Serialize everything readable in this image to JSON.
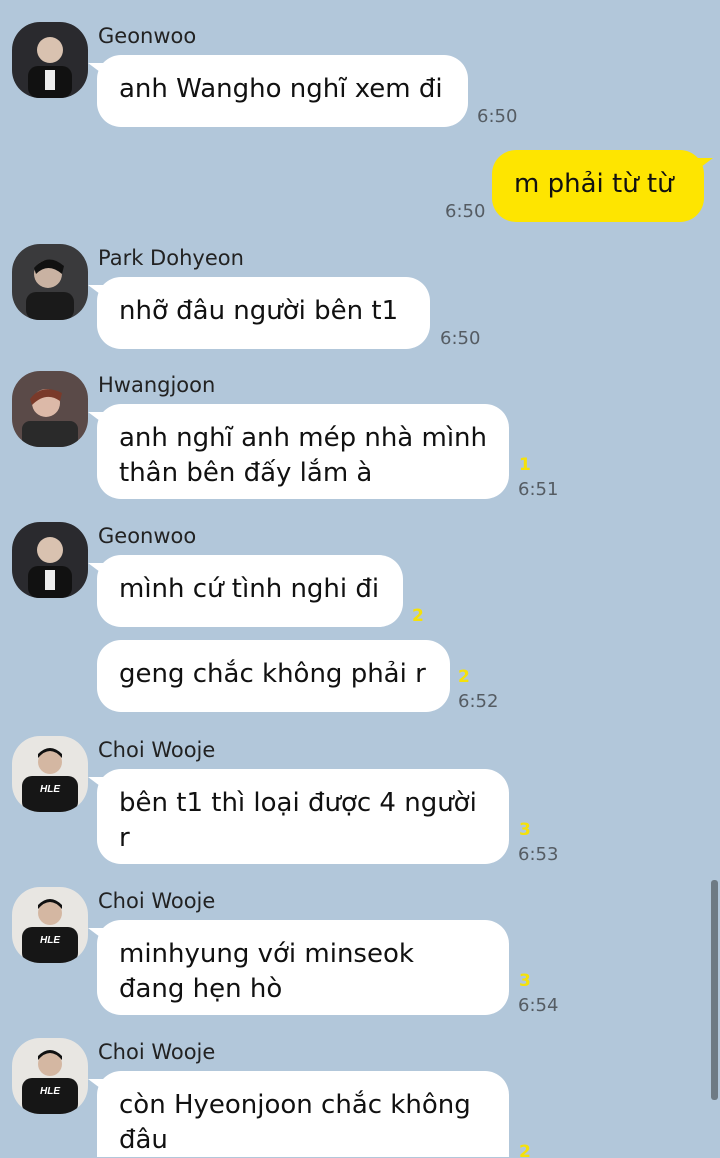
{
  "messages": [
    {
      "sender": "Geonwoo",
      "avatar": "geonwoo-avatar",
      "text": "anh Wangho nghĩ xem đi",
      "time": "6:50"
    },
    {
      "mine": true,
      "text": "m phải từ từ",
      "time": "6:50"
    },
    {
      "sender": "Park Dohyeon",
      "avatar": "park-dohyeon-avatar",
      "text": "nhỡ đâu người bên t1",
      "time": "6:50"
    },
    {
      "sender": "Hwangjoon",
      "avatar": "hwangjoon-avatar",
      "text_lines": [
        "anh nghĩ anh mép nhà mình",
        "thân bên đấy lắm à"
      ],
      "unread": "1",
      "time": "6:51"
    },
    {
      "sender": "Geonwoo",
      "avatar": "geonwoo-avatar",
      "text": "mình cứ tình nghi đi",
      "unread": "2"
    },
    {
      "text": "geng chắc không phải r",
      "unread": "2",
      "time": "6:52"
    },
    {
      "sender": "Choi Wooje",
      "avatar": "choi-wooje-avatar",
      "text_lines": [
        "bên t1 thì loại được 4 người",
        "r"
      ],
      "unread": "3",
      "time": "6:53"
    },
    {
      "sender": "Choi Wooje",
      "avatar": "choi-wooje-avatar",
      "text_lines": [
        "minhyung với minseok",
        "đang hẹn hò"
      ],
      "unread": "3",
      "time": "6:54"
    },
    {
      "sender": "Choi Wooje",
      "avatar": "choi-wooje-avatar",
      "text_lines": [
        "còn Hyeonjoon chắc không",
        "đâu"
      ],
      "unread": "2"
    }
  ],
  "colors": {
    "background": "#b2c7da",
    "my_bubble": "#fee500",
    "other_bubble": "#ffffff",
    "unread": "#f5e10a"
  }
}
